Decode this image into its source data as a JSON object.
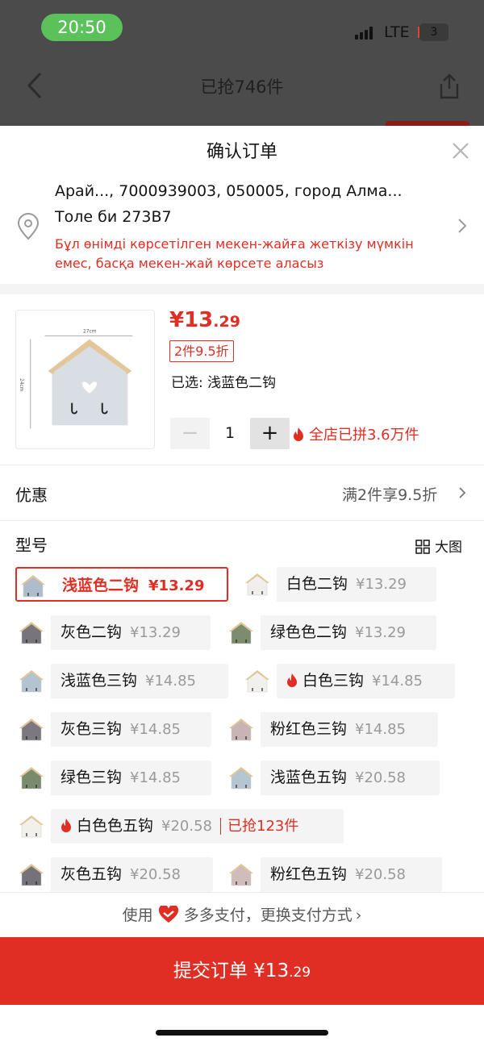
{
  "status_bar": {
    "time": "20:50",
    "network": "LTE",
    "battery": "3"
  },
  "background_page": {
    "title": "已抢746件"
  },
  "sheet": {
    "title": "确认订单"
  },
  "address": {
    "line1": "Арай..., 7000939003, 050005, город Алма...",
    "line2": "Толе би 273B7",
    "warning": "Бұл өнімді көрсетілген мекен-жайға жеткізу мүмкін емес, басқа мекен-жай көрсете аласыз"
  },
  "product": {
    "price_int": "¥13",
    "price_dec": ".29",
    "discount_badge": "2件9.5折",
    "selected": "已选: 浅蓝色二钩",
    "quantity": "1",
    "minus": "−",
    "plus": "+",
    "group_sales": "全店已拼3.6万件",
    "image_labels": {
      "width": "27cm",
      "height": "24cm"
    }
  },
  "promo": {
    "label": "优惠",
    "value": "满2件享9.5折"
  },
  "model": {
    "label": "型号",
    "big_image": "大图",
    "options": [
      {
        "name": "浅蓝色二钩",
        "price": "¥13.29",
        "selected": true,
        "hot": false,
        "thumb_color": "#aebccb"
      },
      {
        "name": "白色二钩",
        "price": "¥13.29",
        "selected": false,
        "hot": false,
        "thumb_color": "#f0efed"
      },
      {
        "name": "灰色二钩",
        "price": "¥13.29",
        "selected": false,
        "hot": false,
        "thumb_color": "#77747a"
      },
      {
        "name": "绿色色二钩",
        "price": "¥13.29",
        "selected": false,
        "hot": false,
        "thumb_color": "#7d8c6e"
      },
      {
        "name": "浅蓝色三钩",
        "price": "¥14.85",
        "selected": false,
        "hot": false,
        "thumb_color": "#b3c4d0"
      },
      {
        "name": "白色三钩",
        "price": "¥14.85",
        "selected": false,
        "hot": true,
        "thumb_color": "#f2f0ec"
      },
      {
        "name": "灰色三钩",
        "price": "¥14.85",
        "selected": false,
        "hot": false,
        "thumb_color": "#7c7880"
      },
      {
        "name": "粉红色三钩",
        "price": "¥14.85",
        "selected": false,
        "hot": false,
        "thumb_color": "#c9b3b4"
      },
      {
        "name": "绿色三钩",
        "price": "¥14.85",
        "selected": false,
        "hot": false,
        "thumb_color": "#7a8a6c"
      },
      {
        "name": "浅蓝色五钩",
        "price": "¥20.58",
        "selected": false,
        "hot": false,
        "thumb_color": "#b6c5d2"
      },
      {
        "name": "白色色五钩",
        "price": "¥20.58",
        "selected": false,
        "hot": true,
        "thumb_color": "#f2f0ec",
        "sold": "已抢123件"
      },
      {
        "name": "灰色五钩",
        "price": "¥20.58",
        "selected": false,
        "hot": false,
        "thumb_color": "#75727a"
      },
      {
        "name": "粉红色五钩",
        "price": "¥20.58",
        "selected": false,
        "hot": false,
        "thumb_color": "#d1bcbc"
      }
    ]
  },
  "payment": {
    "prefix": "使用",
    "method": "多多支付，更换支付方式"
  },
  "submit": {
    "label": "提交订单",
    "price_int": "¥13",
    "price_dec": ".29"
  },
  "colors": {
    "accent": "#e02e24",
    "chip_bg": "#f4f4f4"
  }
}
